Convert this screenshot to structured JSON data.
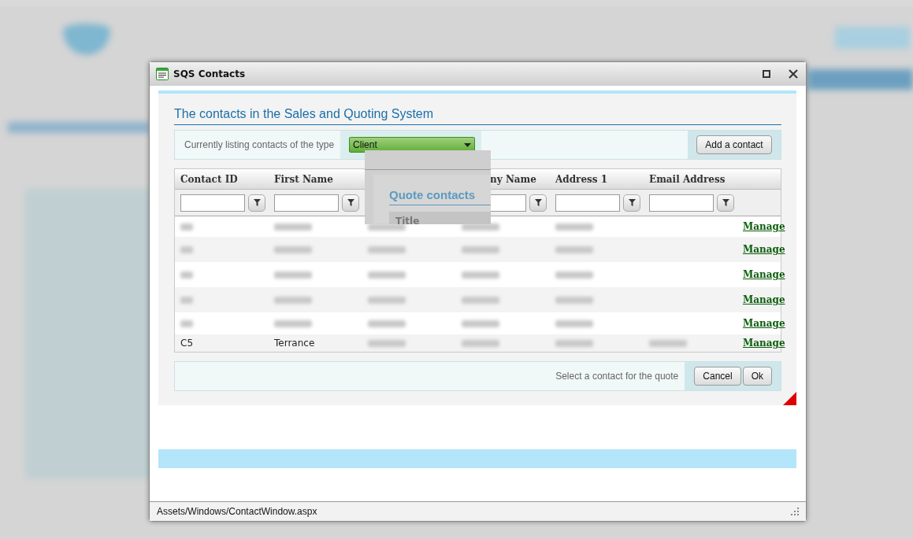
{
  "window": {
    "title": "SQS Contacts",
    "status": "Assets/Windows/ContactWindow.aspx"
  },
  "heading": "The contacts in the Sales and Quoting System",
  "filter_bar": {
    "label": "Currently listing contacts of the type",
    "type_select": {
      "value": "Client"
    },
    "add_button": "Add a contact"
  },
  "dropdown_overlay": {
    "heading": "Quote contacts",
    "column_header": "Title"
  },
  "table": {
    "columns": [
      {
        "label": "Contact ID",
        "filter": true
      },
      {
        "label": "First Name",
        "filter": true
      },
      {},
      {
        "label": "ny Name",
        "filter": true
      },
      {
        "label": "Address 1",
        "filter": true
      },
      {
        "label": "Email Address",
        "filter": true
      }
    ],
    "rows": [
      {
        "link": "Manage"
      },
      {
        "link": "Manage"
      },
      {
        "link": "Manage"
      },
      {
        "link": "Manage"
      },
      {
        "link": "Manage"
      },
      {
        "contact_id": "C5",
        "first_name": "Terrance",
        "link": "Manage"
      }
    ]
  },
  "footer": {
    "hint": "Select a contact for the quote",
    "buttons": [
      "Cancel",
      "Ok"
    ]
  }
}
